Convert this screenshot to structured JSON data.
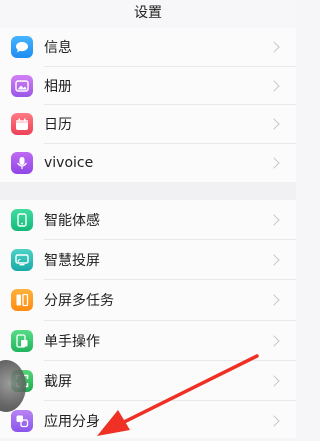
{
  "header": {
    "title": "设置"
  },
  "group1": [
    {
      "label": "信息",
      "icon": "message-bubble-icon"
    },
    {
      "label": "相册",
      "icon": "photo-album-icon"
    },
    {
      "label": "日历",
      "icon": "calendar-icon"
    },
    {
      "label": "vivoice",
      "icon": "microphone-icon"
    }
  ],
  "group2": [
    {
      "label": "智能体感",
      "icon": "smart-motion-icon"
    },
    {
      "label": "智慧投屏",
      "icon": "screen-cast-icon"
    },
    {
      "label": "分屏多任务",
      "icon": "split-screen-icon"
    },
    {
      "label": "单手操作",
      "icon": "one-hand-icon"
    },
    {
      "label": "截屏",
      "icon": "screenshot-icon"
    },
    {
      "label": "应用分身",
      "icon": "app-clone-icon"
    }
  ],
  "colors": {
    "annotation_arrow": "#ee3124",
    "background": "#f6f6f8"
  }
}
